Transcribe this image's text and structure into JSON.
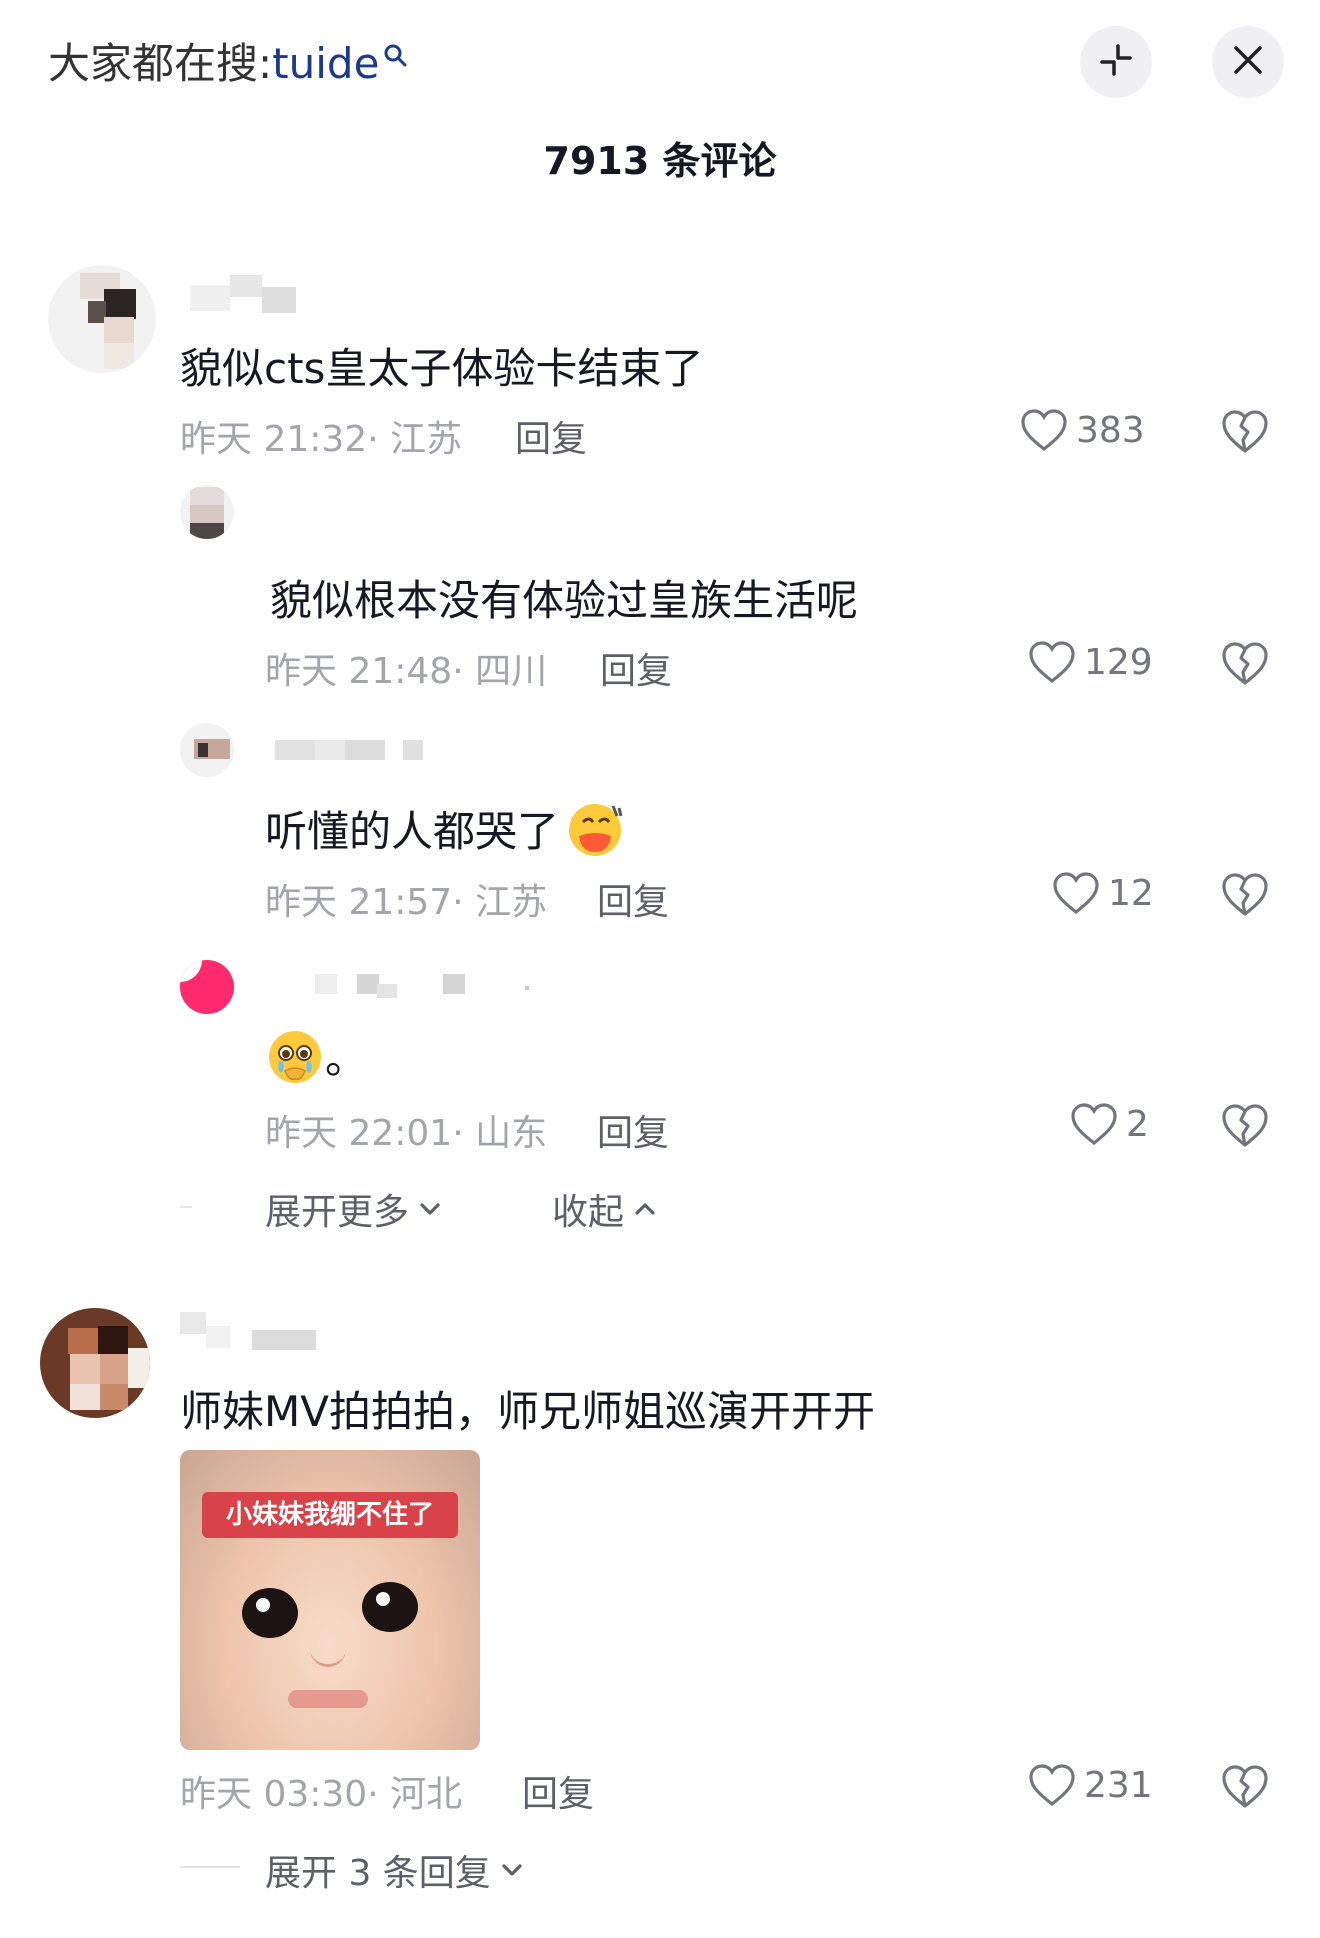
{
  "header": {
    "search_prefix": "大家都在搜:",
    "search_keyword": "tuide",
    "collapse_icon": "collapse-arrows-icon",
    "close_icon": "close-icon"
  },
  "comment_count": "7913 条评论",
  "comments": [
    {
      "text": "貌似cts皇太子体验卡结束了",
      "time": "昨天 21:32",
      "location": "· 江苏",
      "reply_label": "回复",
      "likes": "383",
      "replies": [
        {
          "text": "貌似根本没有体验过皇族生活呢",
          "time": "昨天 21:48",
          "location": "· 四川",
          "reply_label": "回复",
          "likes": "129"
        },
        {
          "text": "听懂的人都哭了",
          "emoji": "sweat-smile-emoji",
          "time": "昨天 21:57",
          "location": "· 江苏",
          "reply_label": "回复",
          "likes": "12"
        },
        {
          "text": "。",
          "emoji": "holding-back-tears-emoji",
          "time": "昨天 22:01",
          "location": "· 山东",
          "reply_label": "回复",
          "likes": "2"
        }
      ],
      "expand_more_label": "展开更多",
      "collapse_label": "收起"
    },
    {
      "text": "师妹MV拍拍拍，师兄师姐巡演开开开",
      "sticker_caption": "小妹妹我绷不住了",
      "time": "昨天 03:30",
      "location": "· 河北",
      "reply_label": "回复",
      "likes": "231",
      "expand_replies_label": "展开 3 条回复"
    }
  ]
}
